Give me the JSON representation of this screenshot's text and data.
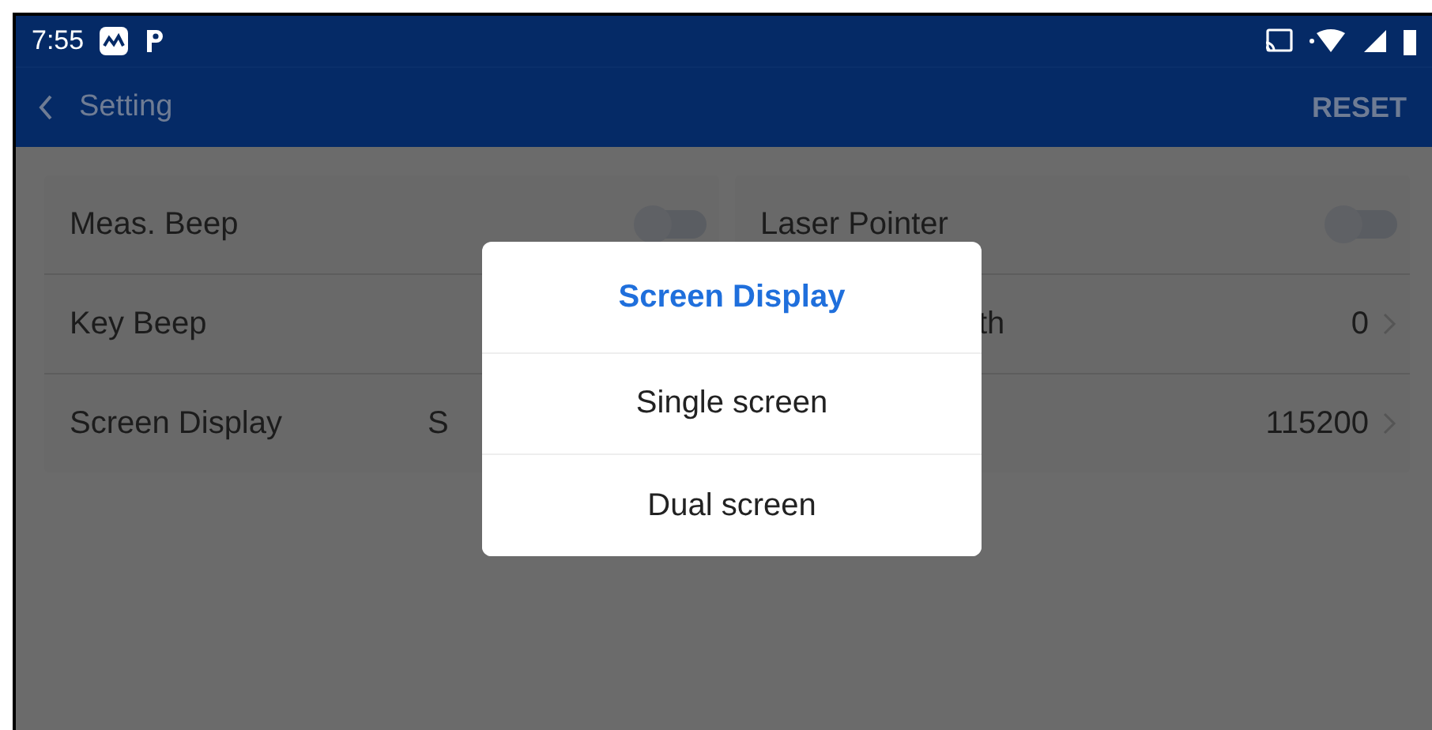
{
  "status_bar": {
    "time": "7:55"
  },
  "app_bar": {
    "title": "Setting",
    "action": "RESET"
  },
  "settings_left": [
    {
      "kind": "toggle",
      "label": "Meas. Beep",
      "on": false
    },
    {
      "kind": "plain",
      "label": "Key Beep"
    },
    {
      "kind": "value",
      "label": "Screen Display",
      "value": "S"
    }
  ],
  "settings_right": [
    {
      "kind": "toggle",
      "label": "Laser Pointer",
      "on": false
    },
    {
      "kind": "link",
      "label": "th",
      "value": "0"
    },
    {
      "kind": "link",
      "value": "115200"
    }
  ],
  "dialog": {
    "title": "Screen Display",
    "options": [
      "Single screen",
      "Dual screen"
    ]
  }
}
